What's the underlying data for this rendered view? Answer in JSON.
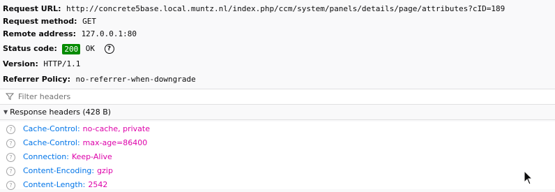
{
  "summary": {
    "request_url": {
      "label": "Request URL:",
      "value": "http://concrete5base.local.muntz.nl/index.php/ccm/system/panels/details/page/attributes?cID=189"
    },
    "request_method": {
      "label": "Request method:",
      "value": "GET"
    },
    "remote_address": {
      "label": "Remote address:",
      "value": "127.0.0.1:80"
    },
    "status_code": {
      "label": "Status code:",
      "code": "200",
      "text": "OK"
    },
    "version": {
      "label": "Version:",
      "value": "HTTP/1.1"
    },
    "referrer_policy": {
      "label": "Referrer Policy:",
      "value": "no-referrer-when-downgrade"
    }
  },
  "filter": {
    "placeholder": "Filter headers"
  },
  "response_headers": {
    "title": "Response headers (428 B)",
    "items": [
      {
        "name": "Cache-Control:",
        "value": "no-cache, private"
      },
      {
        "name": "Cache-Control:",
        "value": "max-age=86400"
      },
      {
        "name": "Connection:",
        "value": "Keep-Alive"
      },
      {
        "name": "Content-Encoding:",
        "value": "gzip"
      },
      {
        "name": "Content-Length:",
        "value": "2542"
      }
    ]
  },
  "colors": {
    "status_ok": "#058b00",
    "header_name": "#0074e8",
    "header_value": "#dd00a9"
  },
  "icons": [
    "help-icon",
    "filter-icon",
    "twisty-down-icon",
    "question-icon",
    "mouse-cursor-icon"
  ]
}
